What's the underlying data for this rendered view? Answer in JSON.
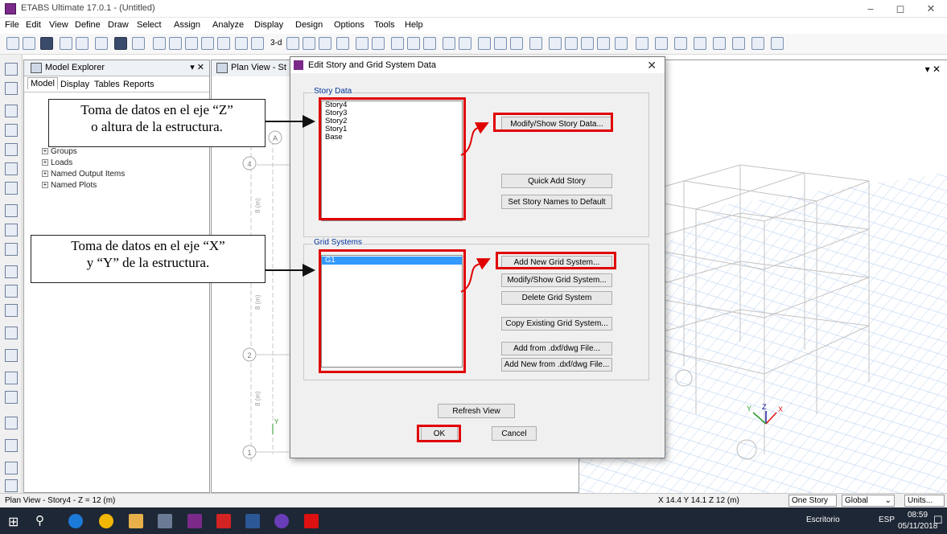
{
  "window": {
    "title": "ETABS Ultimate 17.0.1 - (Untitled)",
    "controls": [
      "–",
      "◻",
      "✕"
    ]
  },
  "menu": [
    "File",
    "Edit",
    "View",
    "Define",
    "Draw",
    "Select",
    "Assign",
    "Analyze",
    "Display",
    "Design",
    "Options",
    "Tools",
    "Help"
  ],
  "toolbar": {
    "text_3d": "3-d"
  },
  "explorer": {
    "title": "Model Explorer",
    "tabs": [
      "Model",
      "Display",
      "Tables",
      "Reports"
    ],
    "tree": [
      "Groups",
      "Loads",
      "Named Output Items",
      "Named Plots"
    ]
  },
  "planview": {
    "tab": "Plan View - St",
    "labels": {
      "a": "A",
      "g4": "4",
      "g2": "2",
      "g1": "1",
      "dim1": "8 (m)",
      "dim2": "8 (m)",
      "dim3": "8 (m)",
      "y": "Y"
    }
  },
  "view3d": {
    "close": "✕",
    "axis": {
      "y": "Y",
      "z": "Z",
      "x": "X"
    }
  },
  "dialog": {
    "title": "Edit Story and Grid System Data",
    "story": {
      "label": "Story Data",
      "items": [
        "Story4",
        "Story3",
        "Story2",
        "Story1",
        "Base"
      ],
      "modify": "Modify/Show Story Data...",
      "quick_add": "Quick Add Story",
      "set_default": "Set Story Names to Default"
    },
    "grid": {
      "label": "Grid Systems",
      "items": [
        "G1"
      ],
      "add": "Add New Grid System...",
      "modify": "Modify/Show Grid System...",
      "delete": "Delete Grid System",
      "copy": "Copy Existing Grid System...",
      "add_dxf": "Add from .dxf/dwg File...",
      "add_new_dxf": "Add New from .dxf/dwg File..."
    },
    "refresh": "Refresh View",
    "ok": "OK",
    "cancel": "Cancel"
  },
  "annotations": {
    "z_line1": "Toma de datos en el eje “Z”",
    "z_line2": "o altura de la estructura.",
    "xy_line1": "Toma de datos en el eje “X”",
    "xy_line2": "y “Y” de la estructura."
  },
  "status": {
    "left": "Plan View - Story4 - Z = 12 (m)",
    "coords": "X 14.4  Y 14.1  Z 12 (m)",
    "story_combo": "One Story",
    "coord_combo": "Global",
    "units": "Units..."
  },
  "taskbar": {
    "escritorio": "Escritorio",
    "lang": "ESP",
    "time": "08:59",
    "date": "05/11/2018"
  },
  "colors": {
    "highlight": "#e00000",
    "selection": "#3399ff",
    "taskbar": "#1e2735",
    "grid_blue": "#a9c8ee"
  }
}
